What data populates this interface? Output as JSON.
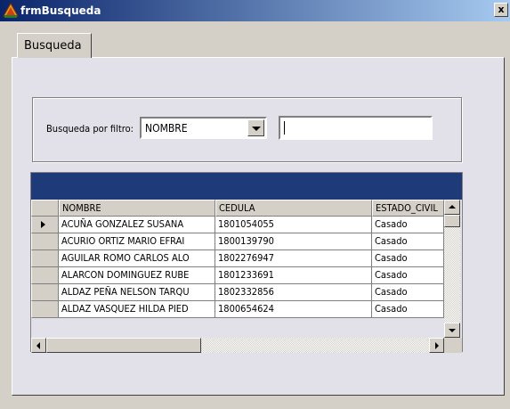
{
  "window": {
    "title": "frmBusqueda",
    "close_glyph": "x"
  },
  "tabs": [
    {
      "label": "Busqueda"
    }
  ],
  "filter": {
    "label": "Busqueda por filtro:",
    "combo_value": "NOMBRE",
    "search_value": ""
  },
  "grid": {
    "columns": [
      "NOMBRE",
      "CEDULA",
      "ESTADO_CIVIL"
    ],
    "rows": [
      {
        "nombre": "ACUÑA GONZALEZ SUSANA",
        "cedula": "1801054055",
        "estado": "Casado"
      },
      {
        "nombre": "ACURIO ORTIZ MARIO EFRAI",
        "cedula": "1800139790",
        "estado": "Casado"
      },
      {
        "nombre": "AGUILAR ROMO CARLOS ALO",
        "cedula": "1802276947",
        "estado": "Casado"
      },
      {
        "nombre": "ALARCON DOMINGUEZ RUBE",
        "cedula": "1801233691",
        "estado": "Casado"
      },
      {
        "nombre": "ALDAZ PEÑA NELSON TARQU",
        "cedula": "1802332856",
        "estado": "Casado"
      },
      {
        "nombre": "ALDAZ VASQUEZ HILDA PIED",
        "cedula": "1800654624",
        "estado": "Casado"
      }
    ],
    "selected_row": 0
  },
  "colors": {
    "caption_bar": "#1f3a78",
    "titlebar_start": "#0a246a"
  },
  "icons": {
    "app": "app-icon",
    "close": "close-icon"
  }
}
